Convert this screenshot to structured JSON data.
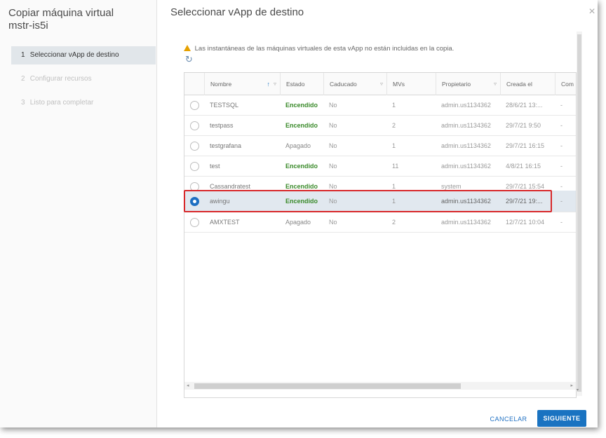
{
  "wizard": {
    "title_line1": "Copiar máquina virtual",
    "title_line2": "mstr-is5i",
    "steps": [
      {
        "num": "1",
        "label": "Seleccionar vApp de destino"
      },
      {
        "num": "2",
        "label": "Configurar recursos"
      },
      {
        "num": "3",
        "label": "Listo para completar"
      }
    ]
  },
  "main": {
    "title": "Seleccionar vApp de destino",
    "warning": "Las instantáneas de las máquinas virtuales de esta vApp no están incluidas en la copia.",
    "close_icon": "close-icon",
    "refresh_icon": "refresh-icon"
  },
  "table": {
    "headers": [
      "Nombre",
      "Estado",
      "Caducado",
      "MVs",
      "Propietario",
      "Creada el",
      "Com"
    ],
    "rows": [
      {
        "name": "TESTSQL",
        "estado": "Encendido",
        "caducado": "No",
        "mvs": "1",
        "propietario": "admin.us1134362",
        "creada": "28/6/21 13:...",
        "com": "-",
        "selected": false
      },
      {
        "name": "testpass",
        "estado": "Encendido",
        "caducado": "No",
        "mvs": "2",
        "propietario": "admin.us1134362",
        "creada": "29/7/21 9:50",
        "com": "-",
        "selected": false
      },
      {
        "name": "testgrafana",
        "estado": "Apagado",
        "caducado": "No",
        "mvs": "1",
        "propietario": "admin.us1134362",
        "creada": "29/7/21 16:15",
        "com": "-",
        "selected": false
      },
      {
        "name": "test",
        "estado": "Encendido",
        "caducado": "No",
        "mvs": "11",
        "propietario": "admin.us1134362",
        "creada": "4/8/21 16:15",
        "com": "-",
        "selected": false
      },
      {
        "name": "Cassandratest",
        "estado": "Encendido",
        "caducado": "No",
        "mvs": "1",
        "propietario": "system",
        "creada": "29/7/21 15:54",
        "com": "-",
        "selected": false
      },
      {
        "name": "awingu",
        "estado": "Encendido",
        "caducado": "No",
        "mvs": "1",
        "propietario": "admin.us1134362",
        "creada": "29/7/21 19:...",
        "com": "-",
        "selected": true
      },
      {
        "name": "AMXTEST",
        "estado": "Apagado",
        "caducado": "No",
        "mvs": "2",
        "propietario": "admin.us1134362",
        "creada": "12/7/21 10:04",
        "com": "-",
        "selected": false
      }
    ]
  },
  "footer": {
    "cancel_label": "CANCELAR",
    "next_label": "SIGUIENTE"
  },
  "colors": {
    "accent": "#1a73c1",
    "powered_on": "#3a8a2a",
    "highlight": "#d8282a",
    "warning": "#e6a100"
  }
}
